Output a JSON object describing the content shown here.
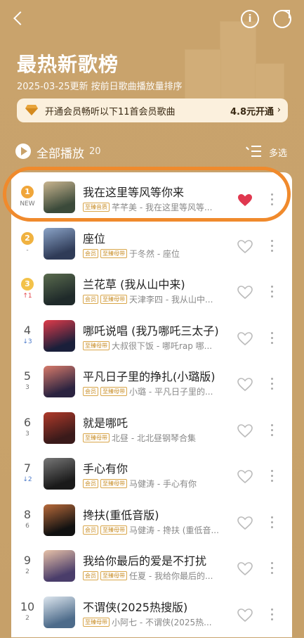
{
  "header": {
    "title": "最热新歌榜",
    "subtitle": "2025-03-25更新 按前日歌曲播放量排序"
  },
  "vip_bar": {
    "text": "开通会员畅听以下11首会员歌曲",
    "price_text": "4.8元开通"
  },
  "toolbar": {
    "play_all_label": "全部播放",
    "count": "20",
    "multi_select_label": "多选"
  },
  "tags": {
    "vip": "会员",
    "master": "至臻母带",
    "master_alt": "至臻音质"
  },
  "songs": [
    {
      "rank": "1",
      "change": "NEW",
      "title": "我在这里等风等你来",
      "meta": "芊芊美 - 我在这里等风等...",
      "liked": true
    },
    {
      "rank": "2",
      "change": "-",
      "title": "座位",
      "meta": "于冬然 - 座位",
      "liked": false
    },
    {
      "rank": "3",
      "change": "↑1",
      "title": "兰花草 (我从山中来)",
      "meta": "天津李四 - 我从山中...",
      "liked": false
    },
    {
      "rank": "4",
      "change": "↓3",
      "title": "哪吒说唱 (我乃哪吒三太子)",
      "meta": "大叔很下饭 - 哪吒rap 哪...",
      "liked": false
    },
    {
      "rank": "5",
      "change": "3",
      "title": "平凡日子里的挣扎(小璐版)",
      "meta": "小璐 - 平凡日子里的...",
      "liked": false
    },
    {
      "rank": "6",
      "change": "3",
      "title": "就是哪吒",
      "meta": "北昼 - 北北昼钢琴合集",
      "liked": false
    },
    {
      "rank": "7",
      "change": "↓2",
      "title": "手心有你",
      "meta": "马健涛 - 手心有你",
      "liked": false
    },
    {
      "rank": "8",
      "change": "6",
      "title": "搀扶(重低音版)",
      "meta": "马健涛 - 搀扶 (重低音...",
      "liked": false
    },
    {
      "rank": "9",
      "change": "2",
      "title": "我给你最后的爱是不打扰",
      "meta": "任夏 - 我给你最后的...",
      "liked": false
    },
    {
      "rank": "10",
      "change": "2",
      "title": "不谓侠(2025热搜版)",
      "meta": "小阿七 - 不谓侠(2025热...",
      "liked": false
    }
  ],
  "colors": {
    "accent": "#c8a26b",
    "heart_active": "#e0384f",
    "highlight": "#f08a2c"
  }
}
